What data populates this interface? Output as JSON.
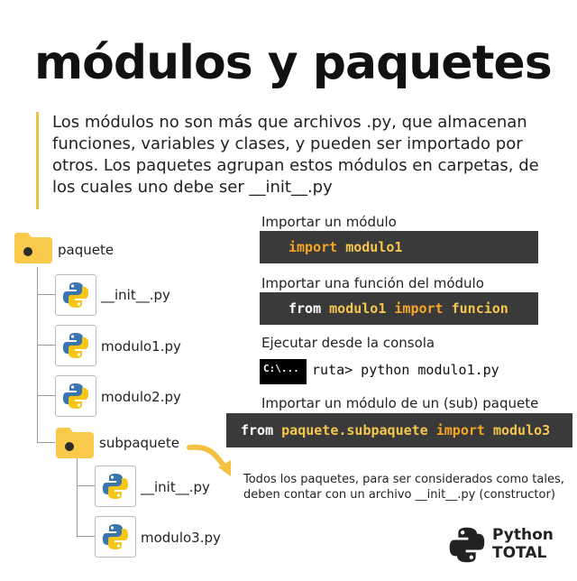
{
  "title": "módulos y paquetes",
  "intro": "Los módulos no son más que archivos .py, que almacenan funciones, variables y clases, y pueden ser importado por otros. Los paquetes agrupan estos módulos en carpetas, de los cuales uno debe ser __init__.py",
  "tree": {
    "root": "paquete",
    "files": [
      "__init__.py",
      "modulo1.py",
      "modulo2.py"
    ],
    "subfolder": "subpaquete",
    "subfiles": [
      "__init__.py",
      "modulo3.py"
    ]
  },
  "sections": {
    "import_module": {
      "label": "Importar un módulo",
      "code": {
        "kw1": "import",
        "mod": "modulo1"
      }
    },
    "import_function": {
      "label": "Importar una función del módulo",
      "code": {
        "kw1": "from",
        "mod": "modulo1",
        "kw2": "import",
        "fn": "funcion"
      }
    },
    "run_console": {
      "label": "Ejecutar desde la consola",
      "icon_text": "C:\\...",
      "command": "ruta> python modulo1.py"
    },
    "import_subpackage": {
      "label": "Importar un módulo de un (sub) paquete",
      "code": {
        "kw1": "from",
        "pkg": "paquete.subpaquete",
        "kw2": "import",
        "mod": "modulo3"
      }
    }
  },
  "note": "Todos los paquetes, para ser considerados como tales, deben contar con un archivo __init__.py (constructor)",
  "brand": {
    "line1": "Python",
    "line2": "TOTAL"
  },
  "colors": {
    "code_bg": "#3a3a3a",
    "keyword": "#f5a623",
    "identifier": "#f5c64f",
    "folder": "#f8c94a",
    "accent_bar": "#f4c242",
    "python_blue": "#3a75b0",
    "python_yellow": "#f5c518"
  }
}
